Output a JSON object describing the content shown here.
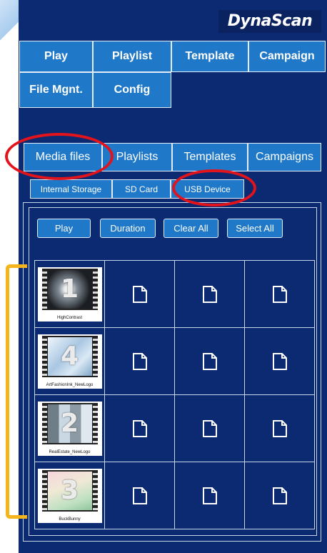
{
  "brand": {
    "logo": "DynaScan"
  },
  "main_nav": {
    "items": [
      "Play",
      "Playlist",
      "Template",
      "Campaign",
      "File Mgnt.",
      "Config"
    ]
  },
  "tabs": [
    "Media files",
    "Playlists",
    "Templates",
    "Campaigns"
  ],
  "storage_tabs": [
    "Internal Storage",
    "SD Card",
    "USB Device"
  ],
  "actions": [
    "Play",
    "Duration",
    "Clear All",
    "Select All"
  ],
  "media": [
    {
      "number": "1",
      "caption": "HighContrast"
    },
    {
      "number": "4",
      "caption": "ArtFashionInk_NewLogo"
    },
    {
      "number": "2",
      "caption": "RealEstate_NewLogo"
    },
    {
      "number": "3",
      "caption": "BuckBunny"
    }
  ],
  "colors": {
    "panel": "#0c2a72",
    "button": "#1f78c8",
    "highlight_oval": "#e3131b",
    "bracket": "#f5b41a"
  },
  "icons": {
    "empty_slot": "file-icon"
  }
}
